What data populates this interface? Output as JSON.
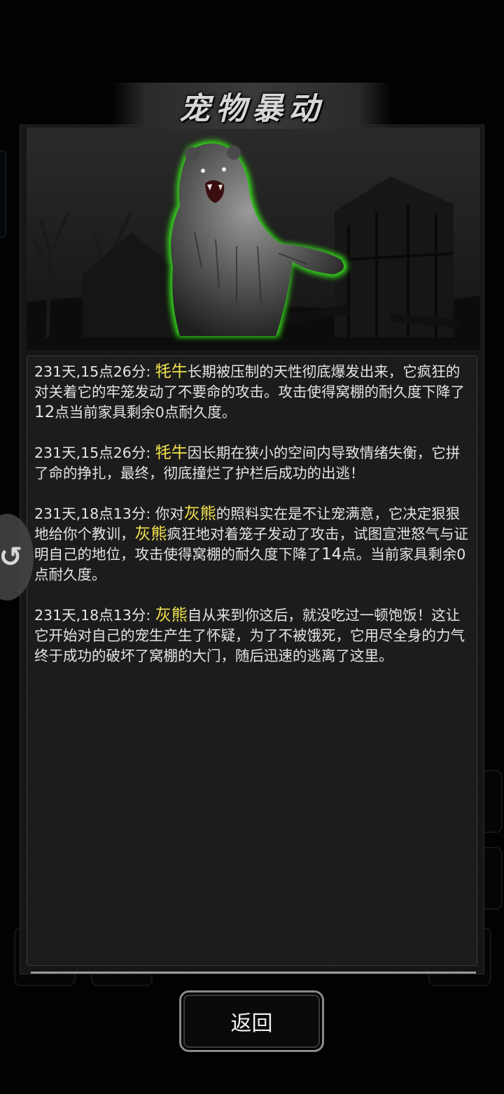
{
  "title": "宠物暴动",
  "side_button_glyph": "↺",
  "log_entries": [
    {
      "time": "231天,15点26分: ",
      "pet": "牦牛",
      "text_a": "长期被压制的天性彻底爆发出来，它疯狂的对关着它的牢笼发动了不要命的攻击。攻击使得窝棚的耐久度下降了",
      "num": "12",
      "text_b": "点当前家具剩余0点耐久度。"
    },
    {
      "time": "231天,15点26分: ",
      "pet": "牦牛",
      "text_a": "因长期在狭小的空间内导致情绪失衡，它拼了命的挣扎，最终，彻底撞烂了护栏后成功的出逃！"
    },
    {
      "time": "231天,18点13分: ",
      "pre": "你对",
      "pet": "灰熊",
      "text_a": "的照料实在是不让宠满意，它决定狠狠地给你个教训，",
      "pet2": "灰熊",
      "text_b": "疯狂地对着笼子发动了攻击，试图宣泄怒气与证明自己的地位，攻击使得窝棚的耐久度下降了",
      "num": "14",
      "text_c": "点。当前家具剩余0点耐久度。"
    },
    {
      "time": "231天,18点13分: ",
      "pet": "灰熊",
      "text_a": "自从来到你这后，就没吃过一顿饱饭！这让它开始对自己的宠生产生了怀疑，为了不被饿死，它用尽全身的力气终于成功的破坏了窝棚的大门，随后迅速的逃离了这里。"
    }
  ],
  "back_button_label": "返回",
  "colors": {
    "pet_name": "#f2e24e",
    "text": "#e4e4e4",
    "glow": "#39e61b"
  },
  "icons": {
    "side_button": "refresh-icon",
    "scene": "bear-illustration"
  }
}
